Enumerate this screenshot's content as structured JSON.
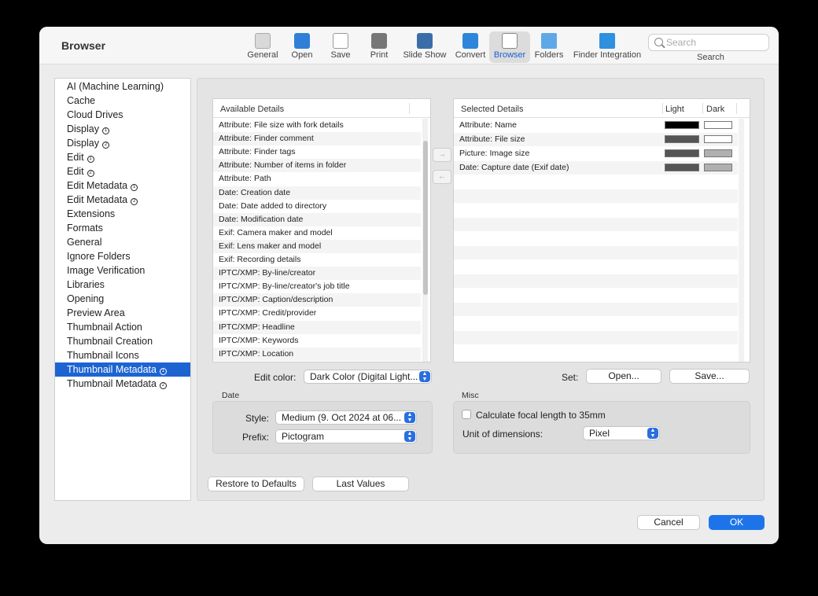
{
  "window": {
    "title": "Browser"
  },
  "toolbar": {
    "items": [
      {
        "label": "General",
        "icon": "general-icon"
      },
      {
        "label": "Open",
        "icon": "open-icon"
      },
      {
        "label": "Save",
        "icon": "save-icon"
      },
      {
        "label": "Print",
        "icon": "print-icon"
      },
      {
        "label": "Slide Show",
        "icon": "slideshow-icon"
      },
      {
        "label": "Convert",
        "icon": "convert-icon"
      },
      {
        "label": "Browser",
        "icon": "browser-icon"
      },
      {
        "label": "Folders",
        "icon": "folders-icon"
      },
      {
        "label": "Finder Integration",
        "icon": "finder-icon"
      }
    ],
    "search": {
      "placeholder": "Search",
      "label": "Search"
    }
  },
  "sidebar": {
    "items": [
      {
        "label": "AI (Machine Learning)",
        "badge": ""
      },
      {
        "label": "Cache",
        "badge": ""
      },
      {
        "label": "Cloud Drives",
        "badge": ""
      },
      {
        "label": "Display",
        "badge": "1"
      },
      {
        "label": "Display",
        "badge": "2"
      },
      {
        "label": "Edit",
        "badge": "1"
      },
      {
        "label": "Edit",
        "badge": "2"
      },
      {
        "label": "Edit Metadata",
        "badge": "1"
      },
      {
        "label": "Edit Metadata",
        "badge": "2"
      },
      {
        "label": "Extensions",
        "badge": ""
      },
      {
        "label": "Formats",
        "badge": ""
      },
      {
        "label": "General",
        "badge": ""
      },
      {
        "label": "Ignore Folders",
        "badge": ""
      },
      {
        "label": "Image Verification",
        "badge": ""
      },
      {
        "label": "Libraries",
        "badge": ""
      },
      {
        "label": "Opening",
        "badge": ""
      },
      {
        "label": "Preview Area",
        "badge": ""
      },
      {
        "label": "Thumbnail Action",
        "badge": ""
      },
      {
        "label": "Thumbnail Creation",
        "badge": ""
      },
      {
        "label": "Thumbnail Icons",
        "badge": ""
      },
      {
        "label": "Thumbnail Metadata",
        "badge": "1"
      },
      {
        "label": "Thumbnail Metadata",
        "badge": "2"
      }
    ]
  },
  "available": {
    "header": "Available Details",
    "rows": [
      "Attribute: File size with fork details",
      "Attribute: Finder comment",
      "Attribute: Finder tags",
      "Attribute: Number of items in folder",
      "Attribute: Path",
      "Date: Creation date",
      "Date: Date added to directory",
      "Date: Modification date",
      "Exif: Camera maker and model",
      "Exif: Lens maker and model",
      "Exif: Recording details",
      "IPTC/XMP: By-line/creator",
      "IPTC/XMP: By-line/creator's job title",
      "IPTC/XMP: Caption/description",
      "IPTC/XMP: Credit/provider",
      "IPTC/XMP: Headline",
      "IPTC/XMP: Keywords",
      "IPTC/XMP: Location"
    ]
  },
  "arrows": {
    "add": "→",
    "remove": "←"
  },
  "selected": {
    "header": "Selected Details",
    "light_header": "Light",
    "dark_header": "Dark",
    "rows": [
      {
        "label": "Attribute: Name",
        "light": "#000000",
        "dark": "#ffffff"
      },
      {
        "label": "Attribute: File size",
        "light": "#555555",
        "dark": "#ffffff"
      },
      {
        "label": "Picture: Image size",
        "light": "#555555",
        "dark": "#b0b0b0"
      },
      {
        "label": "Date: Capture date (Exif date)",
        "light": "#555555",
        "dark": "#b0b0b0"
      }
    ]
  },
  "edit_color": {
    "label": "Edit color:",
    "value": "Dark Color (Digital Light..."
  },
  "set": {
    "label": "Set:",
    "open_label": "Open...",
    "save_label": "Save..."
  },
  "date_group": {
    "title": "Date",
    "style_label": "Style:",
    "style_value": "Medium (9. Oct 2024 at 06...",
    "prefix_label": "Prefix:",
    "prefix_value": "Pictogram"
  },
  "misc_group": {
    "title": "Misc",
    "checkbox_label": "Calculate focal length to 35mm",
    "unit_label": "Unit of dimensions:",
    "unit_value": "Pixel"
  },
  "footer": {
    "restore_label": "Restore to Defaults",
    "last_values_label": "Last Values",
    "cancel_label": "Cancel",
    "ok_label": "OK"
  }
}
